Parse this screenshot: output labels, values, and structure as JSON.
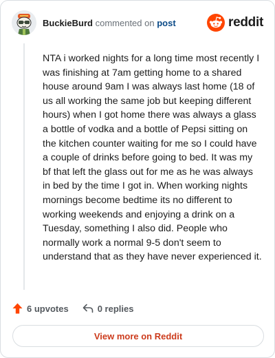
{
  "header": {
    "author": "BuckieBurd",
    "commented_text": "commented on",
    "post_link": "post",
    "brand": "reddit"
  },
  "comment": {
    "body": "NTA i worked nights for a long time most recently I was finishing at 7am getting home to a shared house around 9am I was always last home (18 of us all working the same job but keeping different hours) when I got home there was always a glass a bottle of vodka and a bottle of Pepsi sitting on the kitchen counter waiting for me so I could have a couple of drinks before going to bed. It was my bf that left the glass out for me as he was always in bed by the time I got in. When working nights mornings become bedtime its no different to working weekends and enjoying a drink on a Tuesday, something I also did. People who normally work a normal 9-5 don't seem to understand that as they have never experienced it."
  },
  "actions": {
    "upvotes": "6 upvotes",
    "replies": "0 replies"
  },
  "footer": {
    "view_more": "View more on Reddit"
  },
  "colors": {
    "brand_orange": "#ff4500",
    "link_blue": "#0b4a87",
    "view_more_text": "#cc3b1c"
  },
  "icons": {
    "avatar": "snoo-avatar",
    "logo": "reddit-snoo-icon",
    "upvote": "upvote-arrow-icon",
    "reply": "reply-arrow-icon"
  }
}
